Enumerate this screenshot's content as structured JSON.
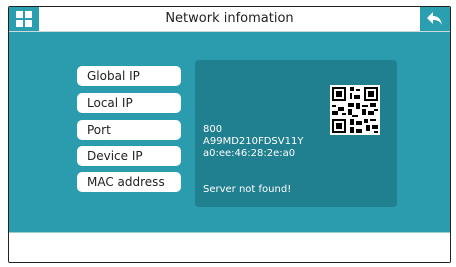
{
  "header": {
    "title": "Network infomation",
    "menu_icon": "grid-icon",
    "back_icon": "back-arrow-icon"
  },
  "buttons": {
    "global_ip": "Global IP",
    "local_ip": "Local IP",
    "port": "Port",
    "device_ip": "Device IP",
    "mac_address": "MAC address"
  },
  "info": {
    "port": "800",
    "device_id": "A99MD210FDSV11Y",
    "mac": "a0:ee:46:28:2e:a0",
    "status": "Server not found!"
  },
  "colors": {
    "accent": "#2a9fb0",
    "content_bg": "#2a9cad",
    "panel_bg": "#21808f"
  }
}
